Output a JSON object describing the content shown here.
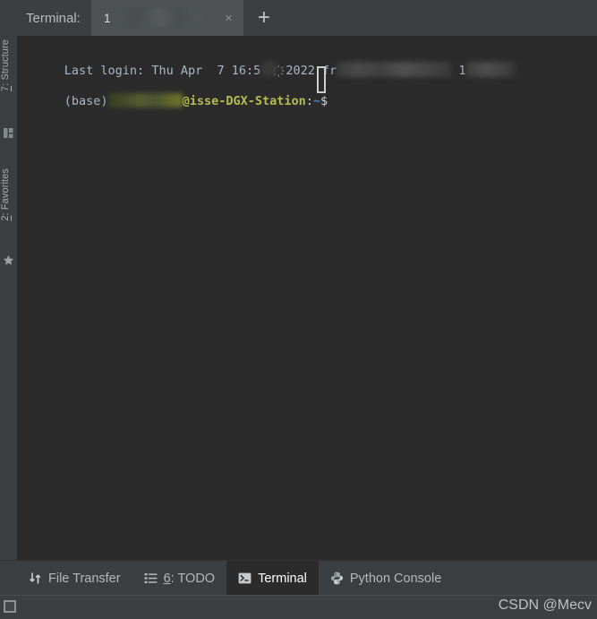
{
  "header": {
    "label": "Terminal:",
    "tab": {
      "title": "1",
      "redacted": true,
      "close_glyph": "×"
    },
    "new_tab_glyph": "+"
  },
  "terminal": {
    "lines": [
      {
        "segments": [
          {
            "text": "Last login: Thu Apr  7 16:5",
            "style": "dim"
          },
          {
            "text": "",
            "style": "blur-dot"
          },
          {
            "text": "҉ 2022 fr",
            "style": "dim"
          },
          {
            "text": "",
            "style": "blur-host1"
          },
          {
            "text": " 1",
            "style": "dim"
          },
          {
            "text": "",
            "style": "blur-host2"
          }
        ]
      },
      {
        "segments": [
          {
            "text": "(base)",
            "style": "dim"
          },
          {
            "text": "",
            "style": "blur-user"
          },
          {
            "text": "@isse-DGX-Station",
            "style": "green"
          },
          {
            "text": ":",
            "style": "white"
          },
          {
            "text": "~",
            "style": "blue"
          },
          {
            "text": "$ ",
            "style": "white"
          }
        ]
      }
    ],
    "raw_line_1": "Last login: Thu Apr  7 16:5  2022 fr          1",
    "raw_line_2": "(base)        @isse-DGX-Station:~$",
    "cursor_visible": true
  },
  "left_sidebar": {
    "items": [
      {
        "label_mnemonic": "7",
        "label": ": Structure",
        "icon": "structure-icon"
      },
      {
        "label_mnemonic": "2",
        "label": ": Favorites",
        "icon": "star-icon"
      }
    ]
  },
  "bottom_bar": {
    "items": [
      {
        "label": "File Transfer",
        "mnemonic": "",
        "icon": "file-transfer-icon",
        "active": false
      },
      {
        "label": ": TODO",
        "mnemonic": "6",
        "icon": "todo-list-icon",
        "active": false
      },
      {
        "label": "Terminal",
        "mnemonic": "",
        "icon": "terminal-icon",
        "active": true
      },
      {
        "label": "Python Console",
        "mnemonic": "",
        "icon": "python-icon",
        "active": false
      }
    ]
  },
  "status_bar": {
    "watermark": "CSDN @Mecv",
    "box_icon": "rectangle-icon"
  },
  "colors": {
    "chrome": "#3c3f41",
    "terminal_bg": "#2b2b2b",
    "tab_active": "#4e5254",
    "prompt_green": "#b5bd4f",
    "prompt_blue": "#3c85c4",
    "text_dim": "#a9b7c6"
  }
}
